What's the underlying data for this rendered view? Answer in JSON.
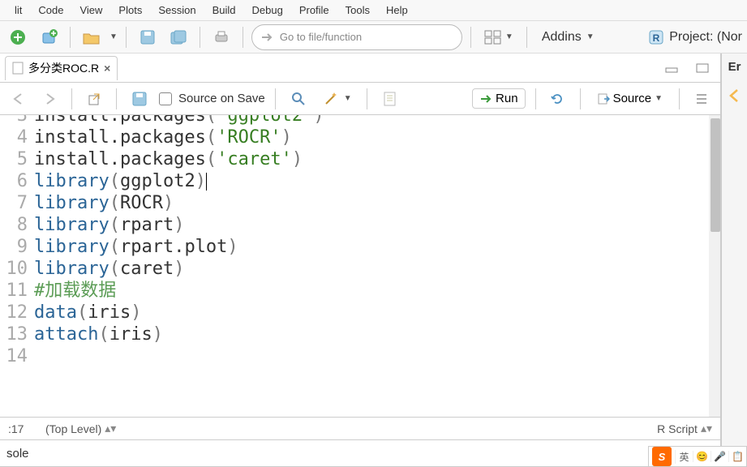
{
  "menu": [
    "lit",
    "Code",
    "View",
    "Plots",
    "Session",
    "Build",
    "Debug",
    "Profile",
    "Tools",
    "Help"
  ],
  "toolbar": {
    "goto_placeholder": "Go to file/function",
    "addins_label": "Addins",
    "project_label": "Project: (Nor"
  },
  "tab": {
    "name": "多分类ROC.R"
  },
  "source_toolbar": {
    "source_on_save": "Source on Save",
    "run": "Run",
    "source": "Source"
  },
  "code_lines": [
    {
      "n": 3,
      "tokens": [
        {
          "t": "install.packages",
          "c": "fn"
        },
        {
          "t": "(",
          "c": "paren"
        },
        {
          "t": "'ggplot2'",
          "c": "str"
        },
        {
          "t": ")",
          "c": "paren"
        }
      ],
      "partial_top": true
    },
    {
      "n": 4,
      "tokens": [
        {
          "t": "install.packages",
          "c": "fn"
        },
        {
          "t": "(",
          "c": "paren"
        },
        {
          "t": "'ROCR'",
          "c": "str"
        },
        {
          "t": ")",
          "c": "paren"
        }
      ]
    },
    {
      "n": 5,
      "tokens": [
        {
          "t": "install.packages",
          "c": "fn"
        },
        {
          "t": "(",
          "c": "paren"
        },
        {
          "t": "'caret'",
          "c": "str"
        },
        {
          "t": ")",
          "c": "paren"
        }
      ]
    },
    {
      "n": 6,
      "tokens": [
        {
          "t": "library",
          "c": "kw"
        },
        {
          "t": "(",
          "c": "paren"
        },
        {
          "t": "ggplot2",
          "c": "fn"
        },
        {
          "t": ")",
          "c": "paren"
        }
      ],
      "cursor_after": true
    },
    {
      "n": 7,
      "tokens": [
        {
          "t": "library",
          "c": "kw"
        },
        {
          "t": "(",
          "c": "paren"
        },
        {
          "t": "ROCR",
          "c": "fn"
        },
        {
          "t": ")",
          "c": "paren"
        }
      ]
    },
    {
      "n": 8,
      "tokens": [
        {
          "t": "library",
          "c": "kw"
        },
        {
          "t": "(",
          "c": "paren"
        },
        {
          "t": "rpart",
          "c": "fn"
        },
        {
          "t": ")",
          "c": "paren"
        }
      ]
    },
    {
      "n": 9,
      "tokens": [
        {
          "t": "library",
          "c": "kw"
        },
        {
          "t": "(",
          "c": "paren"
        },
        {
          "t": "rpart.plot",
          "c": "fn"
        },
        {
          "t": ")",
          "c": "paren"
        }
      ]
    },
    {
      "n": 10,
      "tokens": [
        {
          "t": "library",
          "c": "kw"
        },
        {
          "t": "(",
          "c": "paren"
        },
        {
          "t": "caret",
          "c": "fn"
        },
        {
          "t": ")",
          "c": "paren"
        }
      ]
    },
    {
      "n": 11,
      "tokens": []
    },
    {
      "n": 12,
      "tokens": [
        {
          "t": "#加载数据",
          "c": "com"
        }
      ]
    },
    {
      "n": 13,
      "tokens": [
        {
          "t": "data",
          "c": "kw"
        },
        {
          "t": "(",
          "c": "paren"
        },
        {
          "t": "iris",
          "c": "fn"
        },
        {
          "t": ")",
          "c": "paren"
        }
      ]
    },
    {
      "n": 14,
      "tokens": [
        {
          "t": "attach",
          "c": "kw"
        },
        {
          "t": "(",
          "c": "paren"
        },
        {
          "t": "iris",
          "c": "fn"
        },
        {
          "t": ")",
          "c": "paren"
        }
      ]
    }
  ],
  "status": {
    "pos": ":17",
    "scope": "(Top Level)",
    "type": "R Script"
  },
  "console": {
    "title": "sole"
  },
  "right_panel": {
    "label": "Er"
  },
  "ime": {
    "lang": "英",
    "cells": [
      "😊",
      "🎤",
      "📋"
    ]
  }
}
